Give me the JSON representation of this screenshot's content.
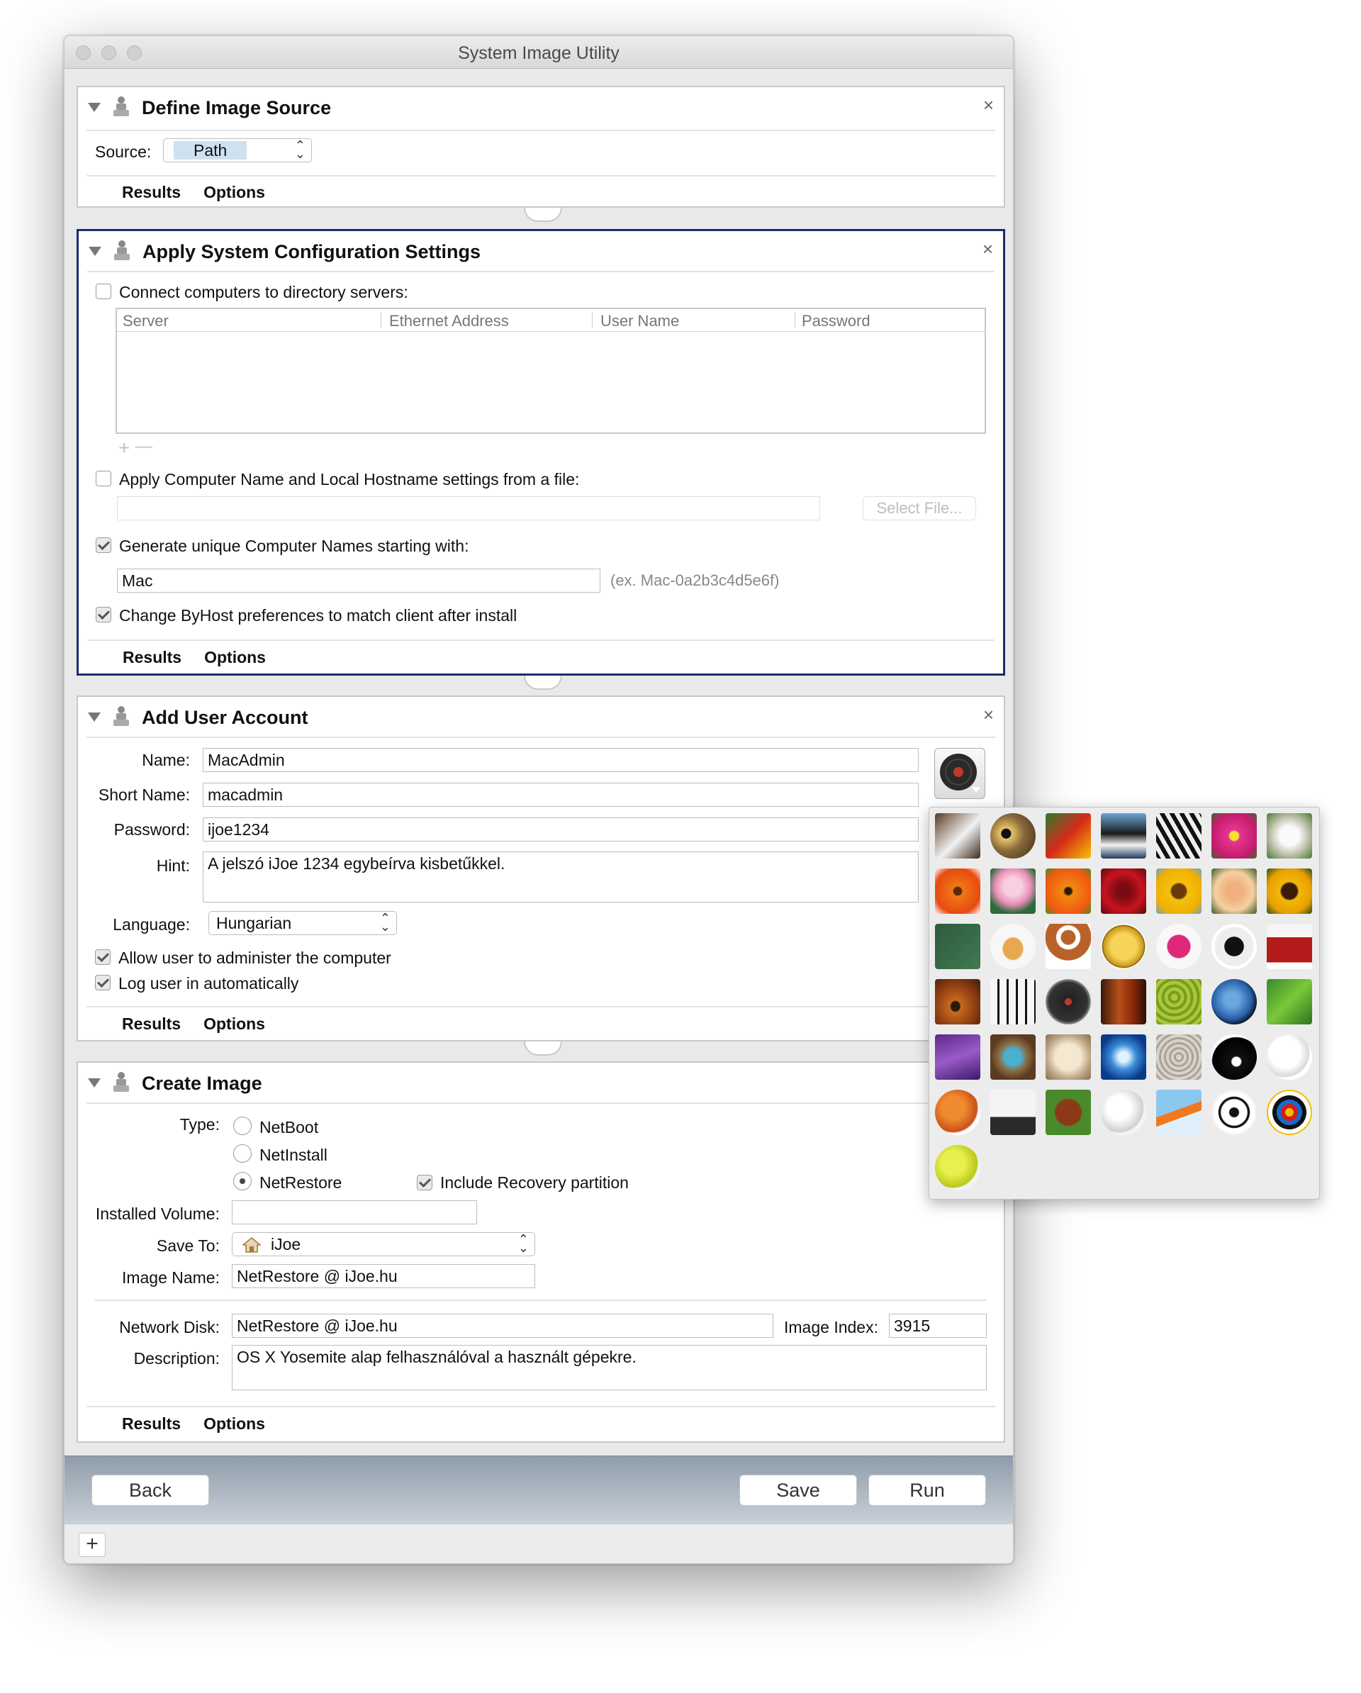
{
  "window": {
    "title": "System Image Utility"
  },
  "define_source": {
    "title": "Define Image Source",
    "source_label": "Source:",
    "source_value": "Path",
    "tab_results": "Results",
    "tab_options": "Options"
  },
  "config": {
    "title": "Apply System Configuration Settings",
    "connect_label": "Connect computers to directory servers:",
    "connect_checked": false,
    "columns": [
      "Server",
      "Ethernet Address",
      "User Name",
      "Password"
    ],
    "add_glyph": "+",
    "remove_glyph": "—",
    "apply_name_label": "Apply Computer Name and Local Hostname settings from a file:",
    "apply_name_checked": false,
    "select_file": "Select File...",
    "generate_label": "Generate unique Computer Names starting with:",
    "generate_checked": true,
    "name_prefix": "Mac",
    "example": "(ex. Mac-0a2b3c4d5e6f)",
    "byhost_label": "Change ByHost preferences to match client after install",
    "byhost_checked": true,
    "tab_results": "Results",
    "tab_options": "Options"
  },
  "user": {
    "title": "Add User Account",
    "name_label": "Name:",
    "name": "MacAdmin",
    "short_label": "Short Name:",
    "short_name": "macadmin",
    "password_label": "Password:",
    "password": "ijoe1234",
    "hint_label": "Hint:",
    "hint": "A jelszó iJoe 1234 egybeírva kisbetűkkel.",
    "language_label": "Language:",
    "language": "Hungarian",
    "admin_label": "Allow user to administer the computer",
    "admin_checked": true,
    "autologin_label": "Log user in automatically",
    "autologin_checked": true,
    "tab_results": "Results",
    "tab_options": "Options"
  },
  "create": {
    "title": "Create Image",
    "type_label": "Type:",
    "types": [
      "NetBoot",
      "NetInstall",
      "NetRestore"
    ],
    "selected_type": "NetRestore",
    "recovery_label": "Include Recovery partition",
    "recovery_checked": true,
    "installed_volume_label": "Installed Volume:",
    "installed_volume": "",
    "save_to_label": "Save To:",
    "save_to": "iJoe",
    "image_name_label": "Image Name:",
    "image_name": "NetRestore @ iJoe.hu",
    "network_disk_label": "Network Disk:",
    "network_disk": "NetRestore @ iJoe.hu",
    "image_index_label": "Image Index:",
    "image_index": "3915",
    "description_label": "Description:",
    "description": "OS X Yosemite alap felhasználóval a használt gépekre.",
    "tab_results": "Results",
    "tab_options": "Options"
  },
  "footer": {
    "back": "Back",
    "save": "Save",
    "run": "Run",
    "add_glyph": "+"
  },
  "picture_picker": {
    "pictures": [
      "eagle",
      "owl",
      "parrot",
      "penguin",
      "zebra",
      "pink-flower",
      "dandelion",
      "orange-flower",
      "lotus",
      "poppy",
      "red-rose",
      "sunflower",
      "yellow-rose",
      "sunflower-2",
      "chalkboard",
      "fortune-cookie",
      "gingerbread-man",
      "gold-coin",
      "lips",
      "yin-yang",
      "drum",
      "guitar",
      "piano",
      "vinyl-record",
      "violin",
      "cactus",
      "earth",
      "leaf",
      "lightning",
      "bird-nest",
      "sand-dollar",
      "snowflake",
      "zen-sand",
      "8-ball",
      "baseball",
      "basketball",
      "bowling",
      "football",
      "golf-ball",
      "hockey",
      "soccer-ball",
      "target",
      "tennis-ball"
    ]
  }
}
